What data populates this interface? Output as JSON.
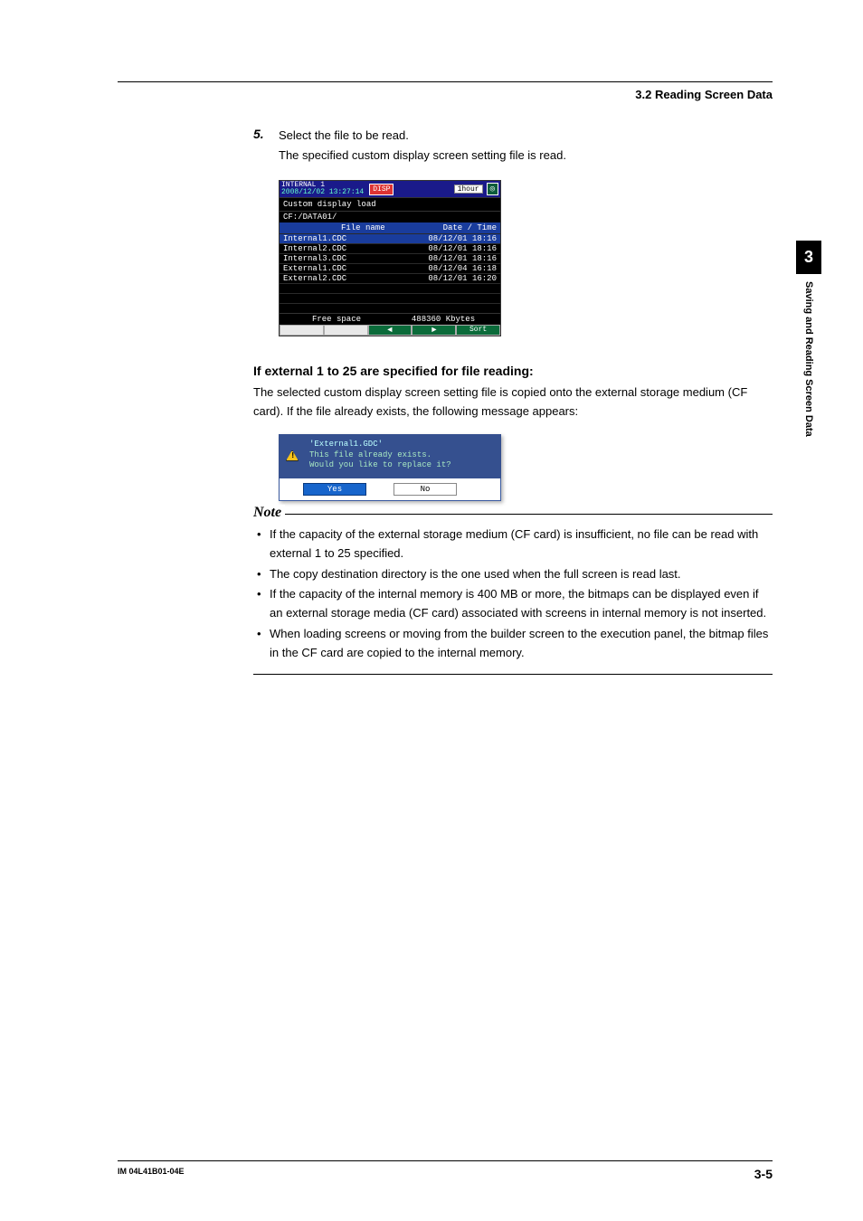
{
  "header": {
    "section": "3.2 Reading Screen Data"
  },
  "step": {
    "num": "5.",
    "title": "Select the file to be read.",
    "desc": "The specified custom display screen setting file is read."
  },
  "screen": {
    "device": "INTERNAL 1",
    "datetime": "2008/12/02 13:27:14",
    "badge": "DISP",
    "interval": "1hour",
    "rec": "◎",
    "title": "Custom display load",
    "path": "CF:/DATA01/",
    "col_name": "File name",
    "col_date": "Date / Time",
    "rows": [
      {
        "name": "Internal1.CDC",
        "date": "08/12/01 18:16",
        "sel": true
      },
      {
        "name": "Internal2.CDC",
        "date": "08/12/01 18:16",
        "sel": false
      },
      {
        "name": "Internal3.CDC",
        "date": "08/12/01 18:16",
        "sel": false
      },
      {
        "name": "External1.CDC",
        "date": "08/12/04 16:18",
        "sel": false
      },
      {
        "name": "External2.CDC",
        "date": "08/12/01 16:20",
        "sel": false
      }
    ],
    "free_label": "Free space",
    "free_value": "488360 Kbytes",
    "keys": {
      "left": "◄",
      "right": "►",
      "sort": "Sort"
    }
  },
  "sub": {
    "heading": "If external 1 to 25 are specified for file reading:",
    "body": "The selected custom display screen setting file is copied onto the external storage medium (CF card). If the file already exists, the following message appears:"
  },
  "dialog": {
    "file": "'External1.GDC'",
    "line1": "This file already exists.",
    "line2": "Would you like to replace it?",
    "yes": "Yes",
    "no": "No"
  },
  "note": {
    "title": "Note",
    "items": [
      "If the capacity of the external storage medium (CF card) is insufficient, no file can be read with external 1 to 25 specified.",
      "The copy destination directory is the one used when the full screen is read last.",
      "If the capacity of the internal memory is 400 MB or more, the bitmaps can be displayed even if an external storage media (CF card) associated with screens in internal memory is not inserted.",
      "When loading screens or moving from the builder screen to the execution panel, the bitmap files in the CF card are copied to the internal memory."
    ]
  },
  "sidetab": {
    "num": "3",
    "label": "Saving and Reading Screen Data"
  },
  "footer": {
    "doc": "IM 04L41B01-04E",
    "page": "3-5"
  }
}
